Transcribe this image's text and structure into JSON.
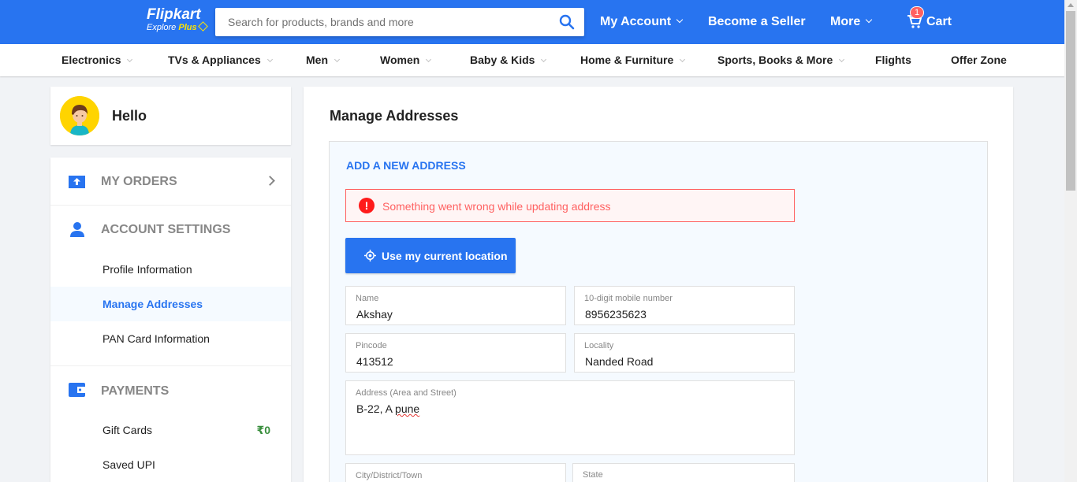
{
  "header": {
    "brand": "Flipkart",
    "brand_sub": "Explore",
    "brand_plus": "Plus",
    "search_placeholder": "Search for products, brands and more",
    "my_account": "My Account",
    "become_seller": "Become a Seller",
    "more": "More",
    "cart": "Cart",
    "cart_count": "1"
  },
  "categories": [
    "Electronics",
    "TVs & Appliances",
    "Men",
    "Women",
    "Baby & Kids",
    "Home & Furniture",
    "Sports, Books & More",
    "Flights",
    "Offer Zone"
  ],
  "sidebar": {
    "hello": "Hello",
    "my_orders": "MY ORDERS",
    "account_settings": "ACCOUNT SETTINGS",
    "profile_information": "Profile Information",
    "manage_addresses": "Manage Addresses",
    "pan_card_information": "PAN Card Information",
    "payments": "PAYMENTS",
    "gift_cards": "Gift Cards",
    "gift_cards_balance": "₹0",
    "saved_upi": "Saved UPI"
  },
  "main": {
    "title": "Manage Addresses",
    "add_new_address": "ADD A NEW ADDRESS",
    "error_message": "Something went wrong while updating address",
    "use_location": "Use my current location",
    "fields": {
      "name_label": "Name",
      "name_value": "Akshay",
      "mobile_label": "10-digit mobile number",
      "mobile_value": "8956235623",
      "pincode_label": "Pincode",
      "pincode_value": "413512",
      "locality_label": "Locality",
      "locality_value": "Nanded Road",
      "address_label": "Address (Area and Street)",
      "address_value_prefix": "B-22, A ",
      "address_value_misspelled": "pune",
      "city_label": "City/District/Town",
      "state_label": "State"
    }
  },
  "colors": {
    "brand_blue": "#2874f0",
    "error_red": "#ff6161",
    "plus_yellow": "#ffe500",
    "rupee_green": "#388e3c"
  }
}
